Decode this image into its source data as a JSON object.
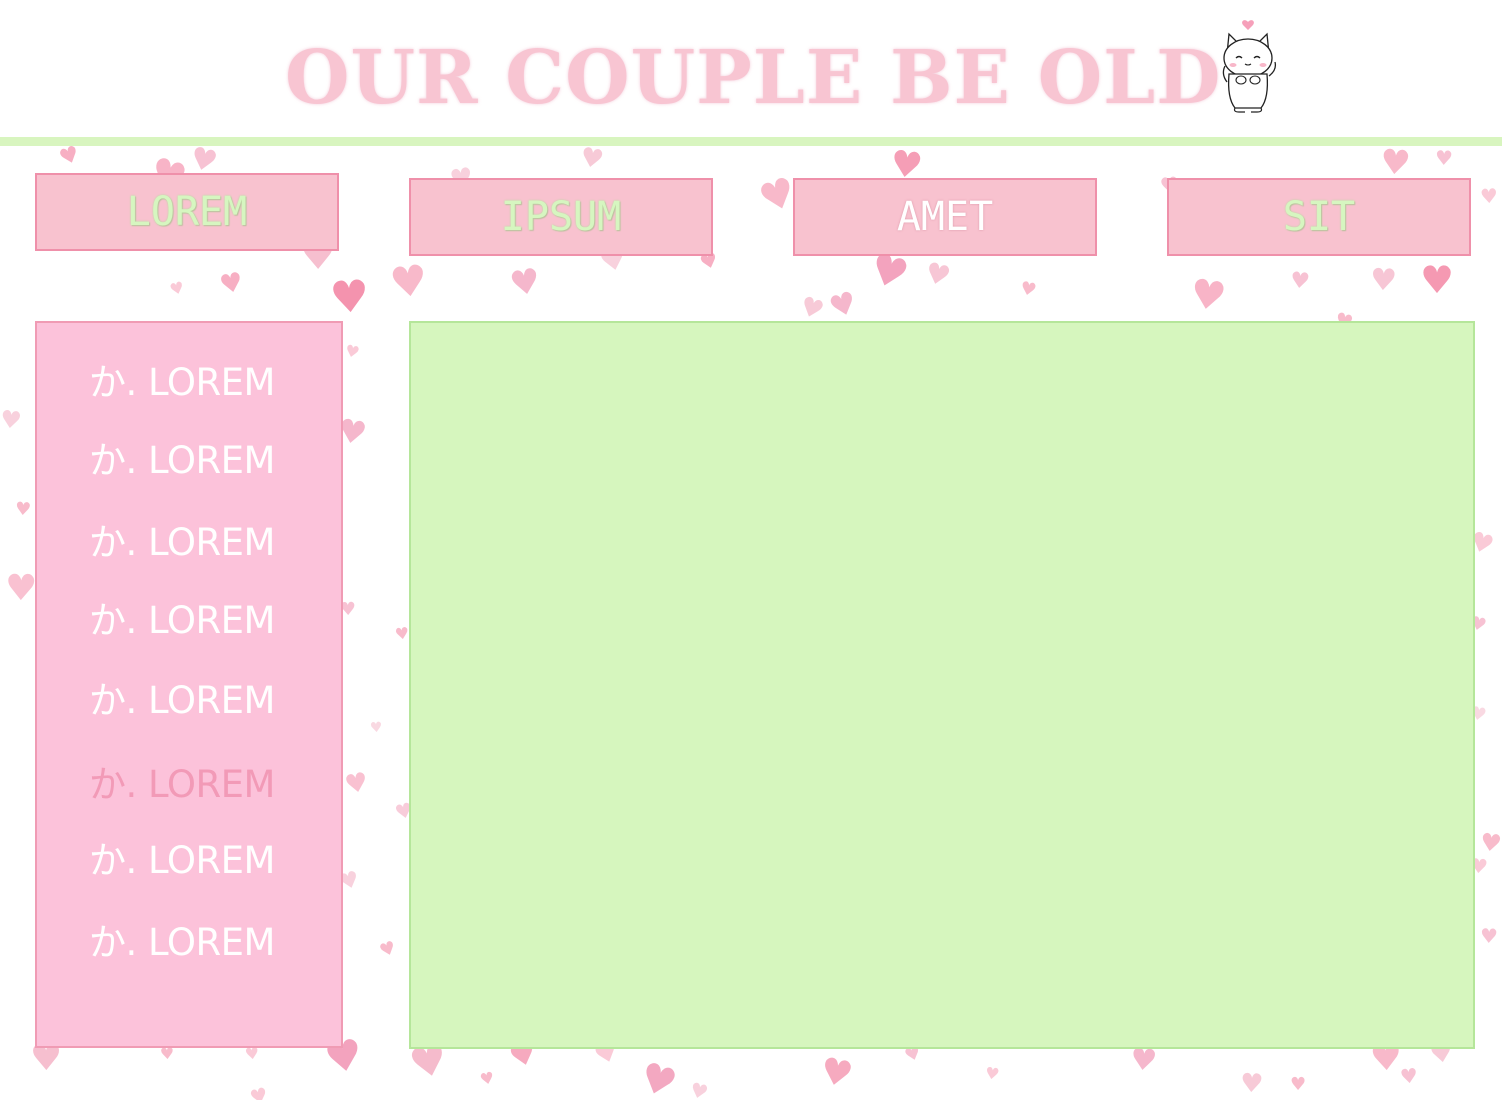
{
  "header": {
    "title": "OUR COUPLE BE OLD",
    "mascot_icon": "cat-waving-icon"
  },
  "nav": {
    "items": [
      {
        "label": "LOREM",
        "text_color": "#d6f6c0"
      },
      {
        "label": "IPSUM",
        "text_color": "#d6f6c0"
      },
      {
        "label": "AMET",
        "text_color": "#ffffff"
      },
      {
        "label": "SIT",
        "text_color": "#d6f6c0"
      }
    ]
  },
  "sidebar": {
    "items": [
      {
        "label": "か. LOREM"
      },
      {
        "label": "か. LOREM"
      },
      {
        "label": "か. LOREM"
      },
      {
        "label": "か. LOREM"
      },
      {
        "label": "か. LOREM"
      },
      {
        "label": "か. LOREM",
        "highlighted": true
      },
      {
        "label": "か. LOREM"
      },
      {
        "label": "か. LOREM"
      }
    ]
  },
  "colors": {
    "title_pink": "#f8c5d2",
    "button_pink": "#f8c2cf",
    "button_border": "#ef90aa",
    "sidebar_pink": "#fcc2da",
    "panel_green": "#d6f6be",
    "rule_green": "#d8f5bf",
    "heart_pink": "#f29ab7"
  },
  "background_icon": "heart-icon"
}
